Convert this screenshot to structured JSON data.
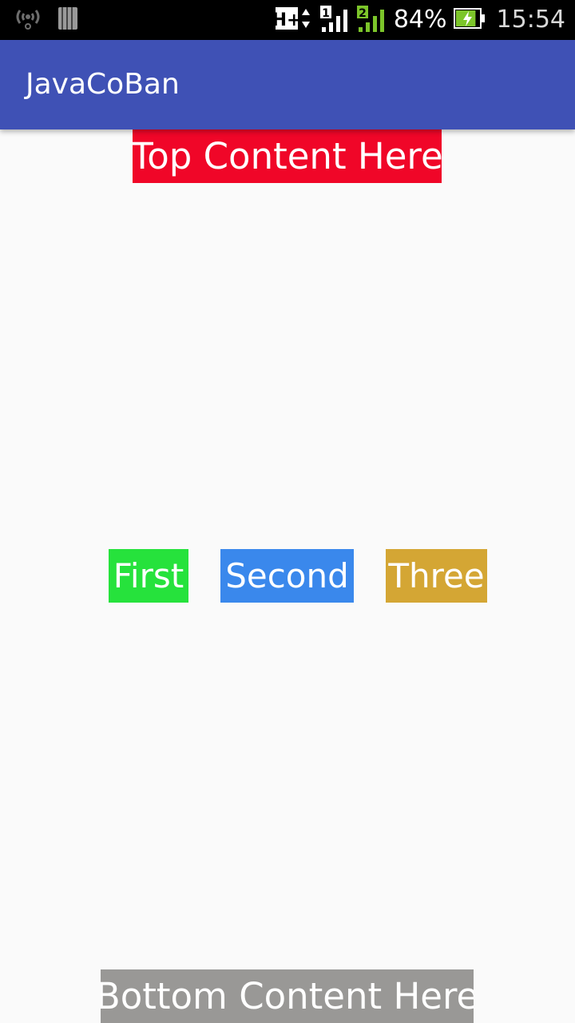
{
  "status_bar": {
    "icons": {
      "left": [
        "wireless-signal-icon",
        "sim-card-icon"
      ],
      "right": [
        "hplus-network-icon",
        "sim1-signal-icon",
        "sim2-signal-icon",
        "battery-charging-icon"
      ]
    },
    "network_label": "H+",
    "sim1_label": "1",
    "sim2_label": "2",
    "battery": "84%",
    "battery_level": 0.84,
    "time": "15:54",
    "colors": {
      "background": "#000000",
      "sim2_signal": "#7cc52a",
      "battery_fill": "#7cc52a"
    }
  },
  "app_bar": {
    "title": "JavaCoBan",
    "color": "#3f51b5"
  },
  "content": {
    "top": {
      "label": "Top Content Here",
      "color": "#f00628"
    },
    "buttons": [
      {
        "label": "First",
        "color": "#26e23c"
      },
      {
        "label": "Second",
        "color": "#3a88ec"
      },
      {
        "label": "Three",
        "color": "#d4a634"
      }
    ],
    "bottom": {
      "label": "Bottom Content Here",
      "color": "#999896"
    }
  }
}
